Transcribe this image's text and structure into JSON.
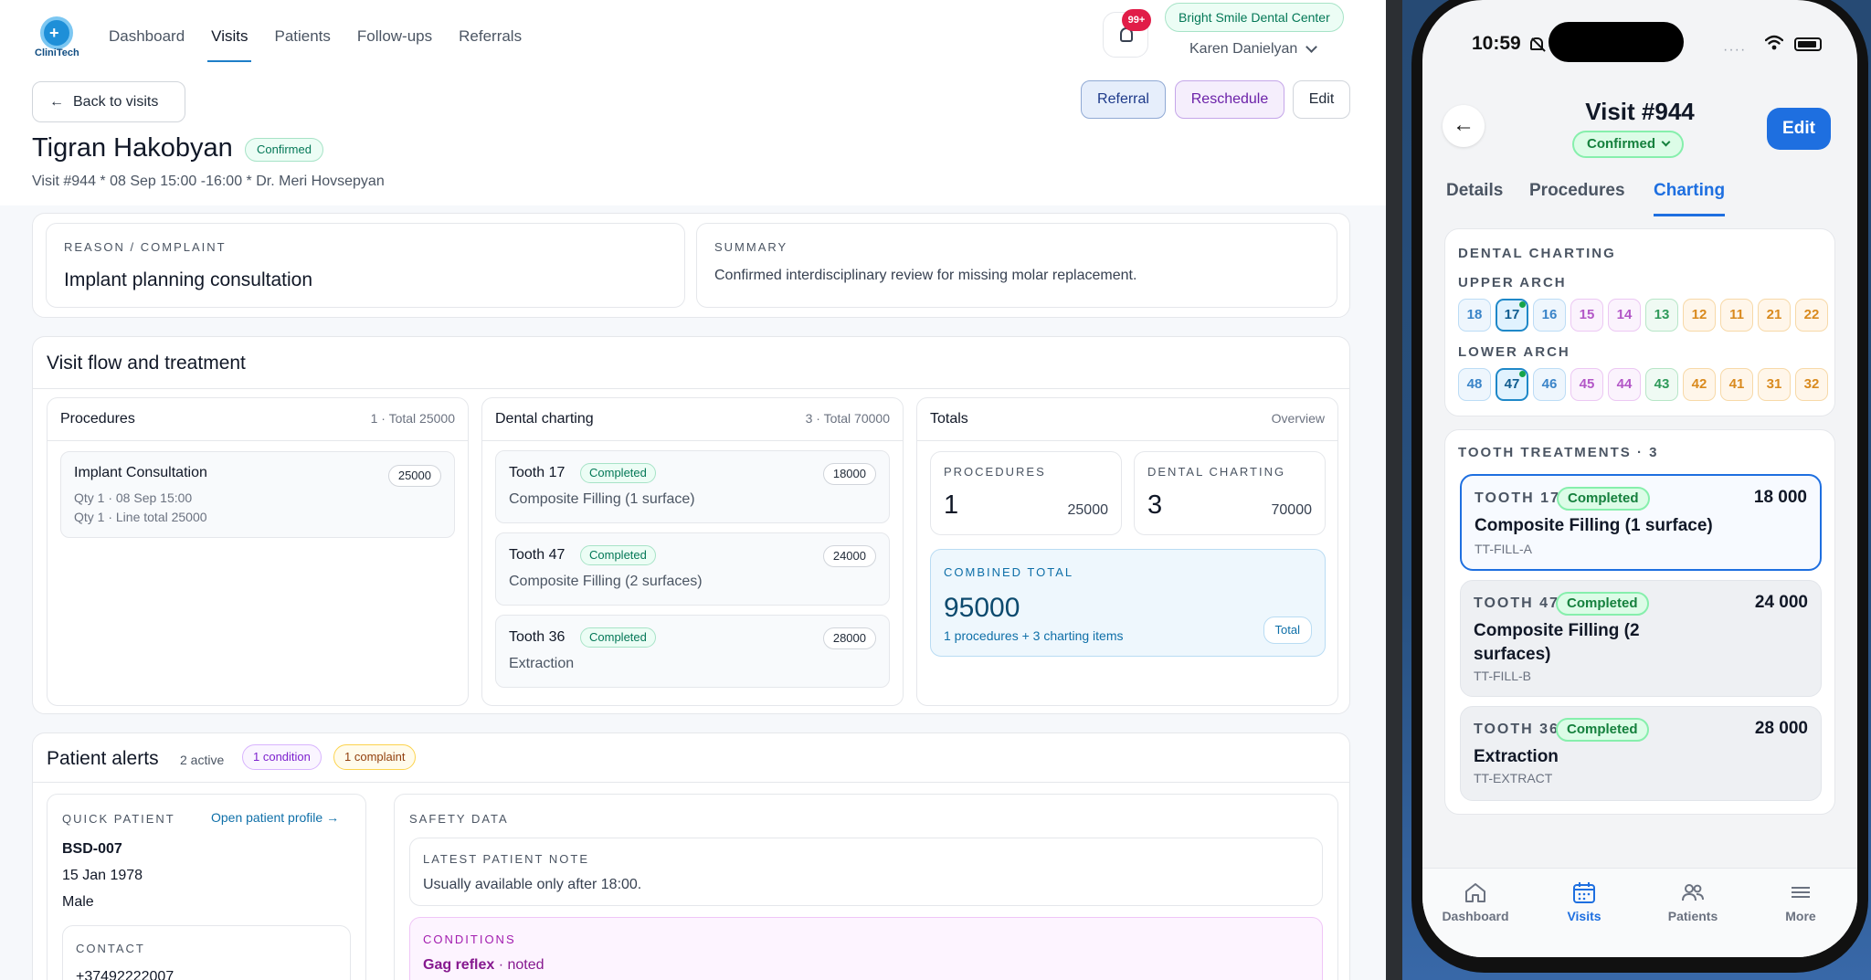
{
  "brand": {
    "logo_text": "CliniTech"
  },
  "nav": [
    "Dashboard",
    "Visits",
    "Patients",
    "Follow-ups",
    "Referrals"
  ],
  "header": {
    "notif_badge": "99+",
    "clinic": "Bright Smile Dental Center",
    "user": "Karen Danielyan"
  },
  "actions": {
    "back": "Back to visits",
    "referral": "Referral",
    "reschedule": "Reschedule",
    "edit": "Edit"
  },
  "visit": {
    "patient": "Tigran Hakobyan",
    "status": "Confirmed",
    "meta": "Visit #944 *  08 Sep 15:00  -16:00  * Dr. Meri Hovsepyan"
  },
  "reason": {
    "label": "REASON / COMPLAINT",
    "value": "Implant planning consultation"
  },
  "summary": {
    "label": "SUMMARY",
    "value": "Confirmed interdisciplinary review for missing molar replacement."
  },
  "flow": {
    "title": "Visit flow and treatment",
    "procedures": {
      "title": "Procedures",
      "meta": "1 · Total 25000",
      "items": [
        {
          "name": "Implant Consultation",
          "price": "25000",
          "line1": "Qty 1 · 08 Sep 15:00",
          "line2": "Qty 1 · Line total 25000"
        }
      ]
    },
    "charting": {
      "title": "Dental charting",
      "meta": "3 · Total 70000",
      "items": [
        {
          "tooth": "Tooth 17",
          "status": "Completed",
          "name": "Composite Filling (1 surface)",
          "price": "18000"
        },
        {
          "tooth": "Tooth 47",
          "status": "Completed",
          "name": "Composite Filling (2 surfaces)",
          "price": "24000"
        },
        {
          "tooth": "Tooth 36",
          "status": "Completed",
          "name": "Extraction",
          "price": "28000"
        }
      ]
    },
    "totals": {
      "title": "Totals",
      "meta": "Overview",
      "procedures_label": "PROCEDURES",
      "procedures_count": "1",
      "procedures_sum": "25000",
      "charting_label": "DENTAL CHARTING",
      "charting_count": "3",
      "charting_sum": "70000",
      "combined_label": "COMBINED TOTAL",
      "combined_value": "95000",
      "combined_note": "1 procedures + 3 charting items",
      "combined_tag": "Total"
    }
  },
  "alerts": {
    "title": "Patient alerts",
    "active": "2 active",
    "tag_condition": "1 condition",
    "tag_complaint": "1 complaint",
    "quick_label": "QUICK PATIENT",
    "open_profile": "Open patient profile →",
    "patient_id": "BSD-007",
    "dob": "15 Jan 1978",
    "sex": "Male",
    "contact_label": "CONTACT",
    "contact_value": "+37492222007",
    "safety_label": "SAFETY DATA",
    "note_label": "LATEST PATIENT NOTE",
    "note_value": "Usually available only after 18:00.",
    "conditions_label": "CONDITIONS",
    "condition_name": "Gag reflex",
    "condition_state": " · noted"
  },
  "phone": {
    "time": "10:59",
    "title": "Visit #944",
    "status": "Confirmed",
    "edit": "Edit",
    "tabs": [
      "Details",
      "Procedures",
      "Charting"
    ],
    "charting_label": "DENTAL CHARTING",
    "upper_label": "UPPER ARCH",
    "lower_label": "LOWER ARCH",
    "upper": [
      "18",
      "17",
      "16",
      "15",
      "14",
      "13",
      "12",
      "11",
      "21",
      "22"
    ],
    "lower": [
      "48",
      "47",
      "46",
      "45",
      "44",
      "43",
      "42",
      "41",
      "31",
      "32"
    ],
    "treatments_label": "TOOTH TREATMENTS · 3",
    "treatments": [
      {
        "tooth": "TOOTH 17",
        "status": "Completed",
        "price": "18 000",
        "name": "Composite Filling (1 surface)",
        "code": "TT-FILL-A"
      },
      {
        "tooth": "TOOTH 47",
        "status": "Completed",
        "price": "24 000",
        "name": "Composite Filling (2 surfaces)",
        "code": "TT-FILL-B"
      },
      {
        "tooth": "TOOTH 36",
        "status": "Completed",
        "price": "28 000",
        "name": "Extraction",
        "code": "TT-EXTRACT"
      }
    ],
    "tabbar": [
      "Dashboard",
      "Visits",
      "Patients",
      "More"
    ]
  }
}
